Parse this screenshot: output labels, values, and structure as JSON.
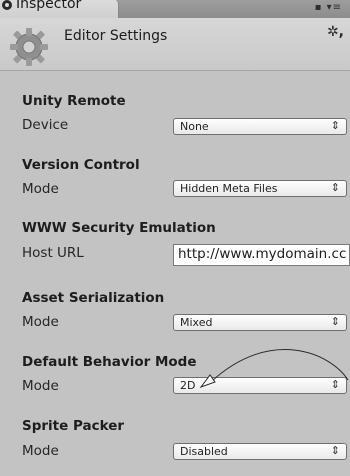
{
  "window": {
    "tab_label": "Inspector",
    "tab_menu_icon": "menu-icon"
  },
  "header": {
    "title": "Editor Settings",
    "icon": "gear-icon",
    "settings_icon": "gear-small-icon"
  },
  "sections": {
    "unity_remote": {
      "title": "Unity Remote",
      "field_label": "Device",
      "value": "None"
    },
    "version_control": {
      "title": "Version Control",
      "field_label": "Mode",
      "value": "Hidden Meta Files"
    },
    "www_security": {
      "title": "WWW Security Emulation",
      "field_label": "Host URL",
      "value": "http://www.mydomain.cc"
    },
    "asset_serialization": {
      "title": "Asset Serialization",
      "field_label": "Mode",
      "value": "Mixed"
    },
    "default_behavior": {
      "title": "Default Behavior Mode",
      "field_label": "Mode",
      "value": "2D"
    },
    "sprite_packer": {
      "title": "Sprite Packer",
      "field_label": "Mode",
      "value": "Disabled"
    }
  },
  "dropdown_arrow": "⇕",
  "annotation": {
    "type": "arrow",
    "color": "#2a2a2a"
  }
}
